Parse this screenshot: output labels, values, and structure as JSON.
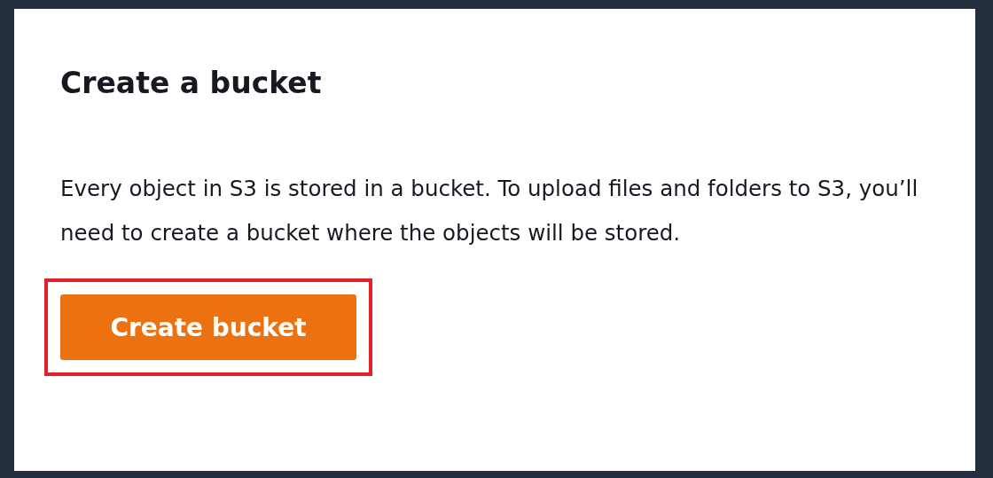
{
  "card": {
    "title": "Create a bucket",
    "description": "Every object in S3 is stored in a bucket. To upload files and folders to S3, you’ll need to create a bucket where the objects will be stored.",
    "button": {
      "label": "Create bucket",
      "highlighted": true
    }
  }
}
